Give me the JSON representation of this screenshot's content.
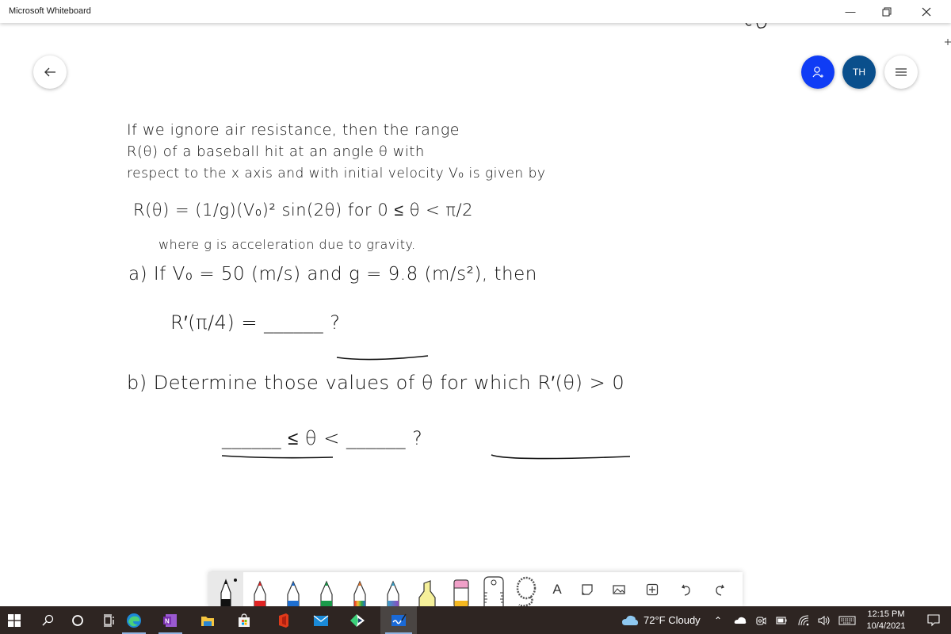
{
  "window": {
    "title": "Microsoft Whiteboard",
    "minimize_icon": "minimize-icon",
    "maximize_icon": "restore-icon",
    "close_icon": "close-icon"
  },
  "top_controls": {
    "back_icon": "arrow-left-icon",
    "invite_icon": "person-add-icon",
    "avatar_initials": "TH",
    "avatar_color": "#0a4f8c",
    "invite_color": "#0f3cf5",
    "menu_icon": "hamburger-icon"
  },
  "whiteboard": {
    "lines": [
      "If we ignore air resistance, then the range",
      "R(θ) of a baseball hit at an angle θ with",
      "respect to the x axis and with initial velocity V₀ is given by",
      "R(θ) = (1/g)(V₀)² sin(2θ)   for   0 ≤ θ < π/2",
      "where g is acceleration due to gravity.",
      "a) If V₀ = 50 (m/s) and g = 9.8 (m/s²), then",
      "R′(π/4) = ______ ?",
      "b) Determine those values of θ for which R′(θ) > 0",
      "______ ≤ θ < ______ ?"
    ]
  },
  "toolbar": {
    "tools": [
      {
        "name": "black-pen",
        "color": "#111111",
        "selected": true
      },
      {
        "name": "red-pen",
        "color": "#e02424"
      },
      {
        "name": "blue-pen",
        "color": "#1e6fd0"
      },
      {
        "name": "green-pen",
        "color": "#1a9a4a"
      },
      {
        "name": "rainbow-pen",
        "color": "#e0742a"
      },
      {
        "name": "galaxy-pen",
        "color": "#3aa0c8"
      },
      {
        "name": "highlighter",
        "color": "#f5f09a"
      },
      {
        "name": "eraser",
        "color": "#f0a0c8"
      },
      {
        "name": "ruler"
      },
      {
        "name": "lasso"
      }
    ],
    "text_label": "A",
    "note_icon": "sticky-note-icon",
    "image_icon": "image-icon",
    "insert_icon": "plus-box-icon",
    "undo_icon": "undo-icon",
    "redo_icon": "redo-icon"
  },
  "taskbar": {
    "apps": [
      "start",
      "search",
      "cortana",
      "task-view",
      "edge",
      "onenote",
      "file-explorer",
      "store",
      "office",
      "mail",
      "kite",
      "whiteboard"
    ],
    "weather": "72°F  Cloudy",
    "time": "12:15 PM",
    "date": "10/4/2021"
  }
}
